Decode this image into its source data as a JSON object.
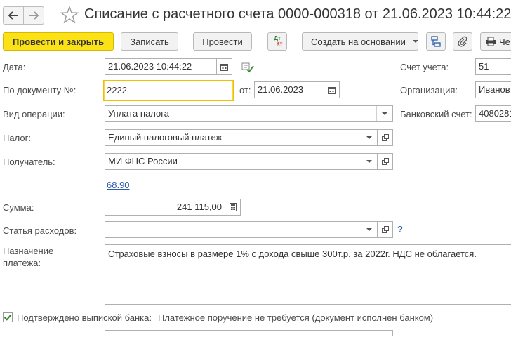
{
  "window": {
    "title": "Списание с расчетного счета 0000-000318 от 21.06.2023 10:44:22 *"
  },
  "toolbar": {
    "post_close_label": "Провести и закрыть",
    "save_label": "Записать",
    "post_label": "Провести",
    "dt_kt_label_dt": "Дт",
    "dt_kt_label_kt": "Кт",
    "create_based_label": "Создать на основании",
    "print_label": "Че"
  },
  "form": {
    "date_label": "Дата:",
    "date_value": "21.06.2023 10:44:22",
    "doc_num_label": "По документу №:",
    "doc_num_value": "2222",
    "from_label": "от:",
    "from_value": "21.06.2023",
    "operation_label": "Вид операции:",
    "operation_value": "Уплата налога",
    "tax_label": "Налог:",
    "tax_value": "Единый налоговый платеж",
    "recipient_label": "Получатель:",
    "recipient_value": "МИ ФНС России",
    "link_value": "68.90",
    "sum_label": "Сумма:",
    "sum_value": "241 115,00",
    "expense_label": "Статья расходов:",
    "expense_value": "",
    "help_mark": "?",
    "purpose_label_1": "Назначение",
    "purpose_label_2": "платежа:",
    "purpose_value": "Страховые взносы в размере 1% с дохода свыше 300т.р. за 2022г. НДС не облагается.",
    "confirmed_label": "Подтверждено выпиской банка:",
    "confirmed_note": "Платежное поручение не требуется (документ исполнен банком)"
  },
  "right": {
    "account_label": "Счет учета:",
    "account_value": "51",
    "org_label": "Организация:",
    "org_value": "Иванов",
    "bank_label": "Банковский счет:",
    "bank_value": "4080281"
  },
  "colors": {
    "primary_button": "#fbe216",
    "link": "#2c5ca8",
    "focus_border": "#f0c000",
    "check_green": "#2e8b2e"
  }
}
